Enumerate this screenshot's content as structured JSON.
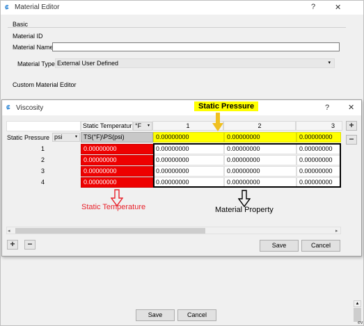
{
  "material_editor": {
    "title": "Material Editor",
    "help_glyph": "?",
    "close_glyph": "✕",
    "basic_section": "Basic",
    "material_id_label": "Material ID",
    "material_name_label": "Material Name",
    "material_name_value": "",
    "material_type_label": "Material Type",
    "material_type_value": "External User Defined",
    "custom_editor_label": "Custom Material Editor",
    "save_label": "Save",
    "cancel_label": "Cancel",
    "cut_text": "ev"
  },
  "viscosity_dialog": {
    "title": "Viscosity",
    "help_glyph": "?",
    "close_glyph": "✕",
    "temp_header_label": "Static Temperatur",
    "temp_unit": "°F",
    "pressure_label": "Static Pressure",
    "pressure_unit": "psi",
    "corner_label": "TS(°F)\\PS(psi)",
    "column_headers": [
      "1",
      "2",
      "3"
    ],
    "pressure_values": [
      "0.00000000",
      "0.00000000",
      "0.00000000"
    ],
    "rows": [
      {
        "label": "1",
        "temperature": "0.00000000",
        "values": [
          "0.00000000",
          "0.00000000",
          "0.00000000"
        ]
      },
      {
        "label": "2",
        "temperature": "0.00000000",
        "values": [
          "0.00000000",
          "0.00000000",
          "0.00000000"
        ]
      },
      {
        "label": "3",
        "temperature": "0.00000000",
        "values": [
          "0.00000000",
          "0.00000000",
          "0.00000000"
        ]
      },
      {
        "label": "4",
        "temperature": "0.00000000",
        "values": [
          "0.00000000",
          "0.00000000",
          "0.00000000"
        ]
      }
    ],
    "add_glyph": "+",
    "remove_glyph": "−",
    "save_label": "Save",
    "cancel_label": "Cancel"
  },
  "annotations": {
    "static_pressure": "Static Pressure",
    "static_temperature": "Static Temperature",
    "material_property": "Material Property",
    "pressure_color": "#ffff00",
    "temperature_color": "#ee0000"
  }
}
